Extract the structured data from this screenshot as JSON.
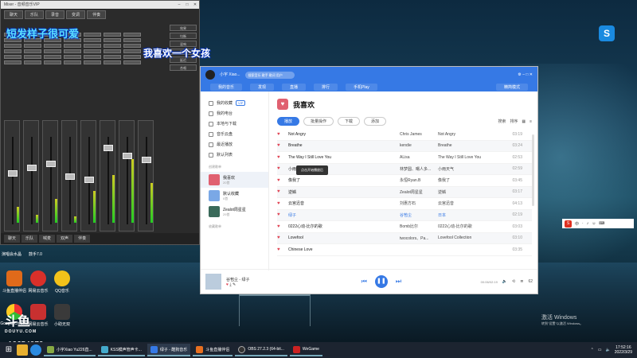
{
  "overlays": {
    "line1": "短发样子很可爱",
    "line2": "我喜欢一个女孩"
  },
  "mixer": {
    "title": "Mixer - 音频音乐VIP",
    "tabs": [
      "聊天",
      "乐队",
      "录音",
      "变调",
      "伴奏"
    ],
    "right_buttons": [
      "效果",
      "均衡",
      "混响",
      "压缩",
      "延迟",
      "合唱"
    ],
    "bottom_buttons": [
      "聊天",
      "乐队",
      "喊麦",
      "双声",
      "伴奏"
    ]
  },
  "desktop": {
    "row1_label_left": "演唱会水晶",
    "row1_label_right": "鼓手7.0",
    "icons": [
      {
        "label": "斗鱼直播伴侣",
        "color": "#e06a1a"
      },
      {
        "label": "网易云音乐",
        "color": "#d8302a"
      },
      {
        "label": "QQ音乐",
        "color": "#f2c21a"
      },
      {
        "label": "Google Chrome",
        "color": "#e8b020"
      },
      {
        "label": "网易云音乐",
        "color": "#c83030"
      },
      {
        "label": "斗鱼直播伴侣",
        "color": "#e87020"
      },
      {
        "label": "小助无双",
        "color": "#3a3a3a"
      }
    ],
    "douyu_logo": "斗鱼",
    "douyu_sub": "DOUYU.COM",
    "room_id": "10654070"
  },
  "music": {
    "user": "小宇\nXiao...",
    "search_placeholder": "搜索音乐 歌手 歌词 用户",
    "nav": [
      "我的音乐",
      "发现",
      "直播",
      "排行",
      "手机Play"
    ],
    "nav_right": "精简模式",
    "sidebar": [
      {
        "label": "我的收藏",
        "badge": "VIP"
      },
      {
        "label": "我的电台"
      },
      {
        "label": "本地与下载"
      },
      {
        "label": "音乐云盘"
      },
      {
        "label": "最近播放"
      },
      {
        "label": "默认列表"
      }
    ],
    "created_heading": "创建歌单",
    "playlists": [
      {
        "title": "我喜欢",
        "count": "20首",
        "color": "#e06070",
        "selected": true
      },
      {
        "title": "默认收藏",
        "count": "0首",
        "color": "#7aa8e6"
      },
      {
        "title": "Zealot周星星",
        "count": "29首",
        "color": "#3a6a5a"
      }
    ],
    "collected_heading": "收藏歌单",
    "heading": "我喜欢",
    "actions": [
      "播放",
      "批量操作",
      "下载",
      "添加"
    ],
    "tools": [
      "搜索",
      "排序"
    ],
    "tooltip": "点击开始播放后",
    "songs": [
      {
        "title": "Not Angry",
        "artist": "Chris James",
        "album": "Not Angry",
        "dur": "03:19"
      },
      {
        "title": "Breathe",
        "artist": "kendie",
        "album": "Breathe",
        "dur": "03:24"
      },
      {
        "title": "The Way I Still Love You",
        "artist": "ALisa",
        "album": "The Way I Still Love You",
        "dur": "02:53"
      },
      {
        "title": "小雨天气",
        "artist": "林梦圆、曙人多...",
        "album": "小雨天气",
        "dur": "02:59"
      },
      {
        "title": "像我了",
        "artist": "永恒Ryan.B",
        "album": "像我了",
        "dur": "03:45"
      },
      {
        "title": "逆鳞",
        "artist": "Zealot周星星",
        "album": "逆鳞",
        "dur": "03:17"
      },
      {
        "title": "云宫迅音",
        "artist": "刘惠方石",
        "album": "云宫迅音",
        "dur": "04:13"
      },
      {
        "title": "绿子",
        "artist": "谷苞尘",
        "album": "日本",
        "dur": "02:19"
      },
      {
        "title": "0222心动-比尔的歌",
        "artist": "Bomb比尔",
        "album": "0222心动-比尔的歌",
        "dur": "03:03"
      },
      {
        "title": "Lovefool",
        "artist": "twocolors、Pa...",
        "album": "Lovefool Collection",
        "dur": "03:10"
      },
      {
        "title": "Chinese Love",
        "artist": "",
        "album": "",
        "dur": "03:35"
      }
    ],
    "player": {
      "title": "谷苞尘 - 绿子",
      "time": "00:06/02:19",
      "count": "62"
    }
  },
  "right": {
    "logo": "S",
    "ime": [
      "中",
      "·",
      "♪",
      "☺",
      "⌨"
    ],
    "activate_title": "激活 Windows",
    "activate_sub": "转到\"设置\"以激活 Windows。"
  },
  "taskbar": {
    "items": [
      {
        "label": "小宇Xiao Yu226直...",
        "color": "#8a4"
      },
      {
        "label": "KSS模声管声卡...",
        "color": "#4ac"
      },
      {
        "label": "绿子 - 酷狗音乐",
        "color": "#3679e5",
        "active": true
      },
      {
        "label": "斗鱼直播伴侣",
        "color": "#e87020"
      },
      {
        "label": "OBS 27.2.3 (64-bit...",
        "color": "#333"
      },
      {
        "label": "WeGame",
        "color": "#c22"
      }
    ],
    "time": "17:52:16",
    "date": "2022/3/29"
  }
}
